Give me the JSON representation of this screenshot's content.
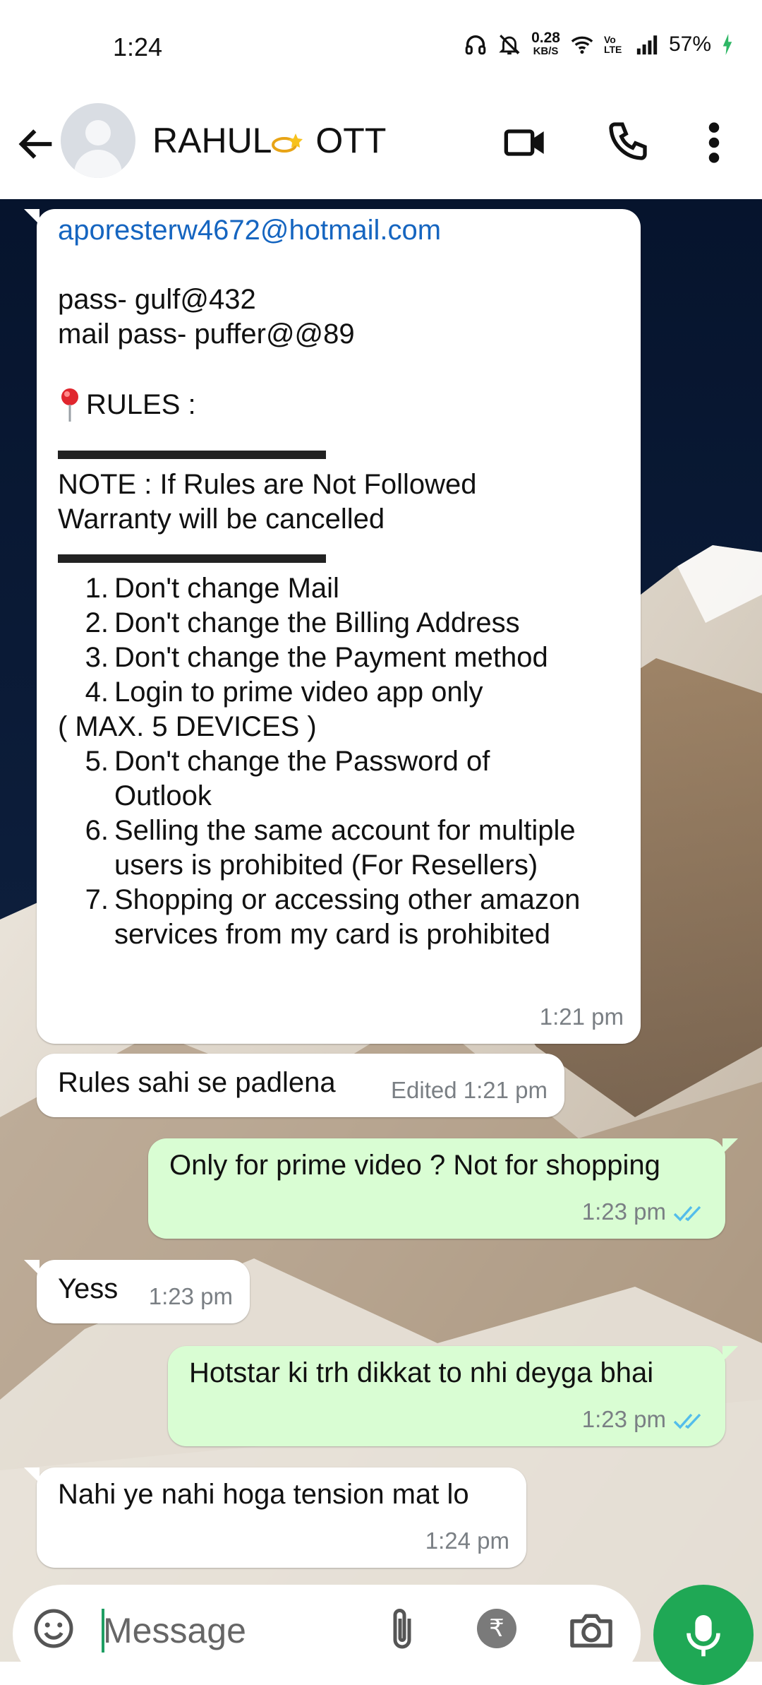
{
  "status_bar": {
    "time": "1:24",
    "net_speed_value": "0.28",
    "net_speed_unit": "KB/S",
    "volte": "Vo LTE",
    "battery": "57%"
  },
  "header": {
    "contact_name_part1": "RAHUL",
    "contact_name_part2": "OTT"
  },
  "messages": {
    "m1": {
      "email": "aporesterw4672@hotmail.com",
      "pass_line": "pass- gulf@432",
      "mail_pass_line": "mail pass- puffer@@89",
      "rules_heading": "RULES :",
      "divider": "▬▬▬▬▬▬▬▬▬▬▬",
      "note_line1": "NOTE : If Rules are Not Followed",
      "note_line2": "Warranty will be cancelled",
      "rules": [
        {
          "num": "1.",
          "text": "Don't change Mail"
        },
        {
          "num": "2.",
          "text": "Don't change the Billing Address"
        },
        {
          "num": "3.",
          "text": "Don't change the Payment method"
        },
        {
          "num": "4.",
          "text": "Login to prime video app only"
        }
      ],
      "max_devices": "( MAX. 5 DEVICES )",
      "rules2": [
        {
          "num": "5.",
          "text": "Don't change the Password of Outlook"
        },
        {
          "num": "6.",
          "text": "Selling the same account for multiple users is prohibited (For Resellers)"
        },
        {
          "num": "7.",
          "text": "Shopping or accessing other amazon services from my card is prohibited"
        }
      ],
      "time": "1:21 pm"
    },
    "m2": {
      "text": "Rules sahi se padlena",
      "time": "Edited 1:21 pm"
    },
    "m3": {
      "text": "Only for prime video ? Not for shopping",
      "time": "1:23 pm"
    },
    "m4": {
      "text": "Yess",
      "time": "1:23 pm"
    },
    "m5": {
      "text": "Hotstar ki trh dikkat to nhi deyga bhai",
      "time": "1:23 pm"
    },
    "m6": {
      "text": "Nahi ye nahi hoga tension mat lo",
      "time": "1:24 pm"
    }
  },
  "input": {
    "placeholder": "Message",
    "rupee_symbol": "₹"
  },
  "colors": {
    "outgoing_bubble": "#d9fdd3",
    "incoming_bubble": "#ffffff",
    "read_ticks": "#53bdeb",
    "mic_button": "#1fa855",
    "link": "#1565c0"
  }
}
